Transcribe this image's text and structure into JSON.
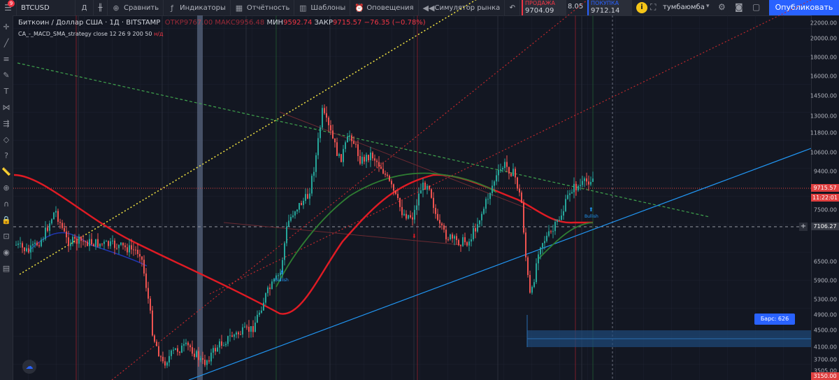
{
  "toolbar": {
    "notification_count": "9",
    "symbol": "BTCUSD",
    "interval": "Д",
    "compare": "Сравнить",
    "indicators": "Индикаторы",
    "reports": "Отчётность",
    "templates": "Шаблоны",
    "alerts": "Оповещения",
    "simulator": "Симулятор рынка",
    "sell_label": "ПРОДАЖА",
    "sell_value": "9704.09",
    "spread": "8.05",
    "buy_label": "ПОКУПКА",
    "buy_value": "9712.14",
    "username": "тумбаюмба",
    "publish": "Опубликовать"
  },
  "legend": {
    "title": "Биткоин / Доллар США · 1Д · BITSTAMP",
    "ohlc_text": "ОТКР9767.00 МАКС9956.48",
    "low_label": "МИН",
    "low_value": "9592.74",
    "close_label": "ЗАКР",
    "close_value": "9715.57",
    "change": "−76.35 (−0.78%)",
    "indicator_name": "CA_-_MACD_SMA_strategy",
    "indicator_params": "close 12 26 9 200 50",
    "indicator_value": "н/д"
  },
  "price_axis": {
    "ticks": [
      "22000.00",
      "20000.00",
      "18000.00",
      "16000.00",
      "14500.00",
      "13000.00",
      "11800.00",
      "10600.00",
      "9400.00",
      "8300.00",
      "7500.00",
      "6500.00",
      "5900.00",
      "5300.00",
      "4900.00",
      "4500.00",
      "4100.00",
      "3700.00",
      "3505.00",
      "3245.00"
    ],
    "last_price_tag": "9715.57",
    "countdown_tag": "11:22:01",
    "crosshair_tag": "7106.27",
    "bottom_tag": "3150.00"
  },
  "chart": {
    "bars_count_label": "Барс: 626",
    "signal_buy": "Bullish\n+1",
    "signal_sell": "Bearish\n-1"
  },
  "colors": {
    "background": "#131722",
    "up": "#26a69a",
    "down": "#ef5350",
    "sma_red": "#e01b24",
    "sma_green": "#2e7d32",
    "trend_blue": "#2196f3",
    "accent": "#2962ff"
  },
  "icons": [
    "menu-icon",
    "candles-icon",
    "plus-circle-icon",
    "indicators-icon",
    "reports-icon",
    "templates-icon",
    "alert-icon",
    "simulator-icon",
    "undo-icon",
    "redo-icon",
    "info-icon",
    "fullscreen-icon",
    "settings-icon",
    "camera-icon",
    "crosshair-icon"
  ]
}
